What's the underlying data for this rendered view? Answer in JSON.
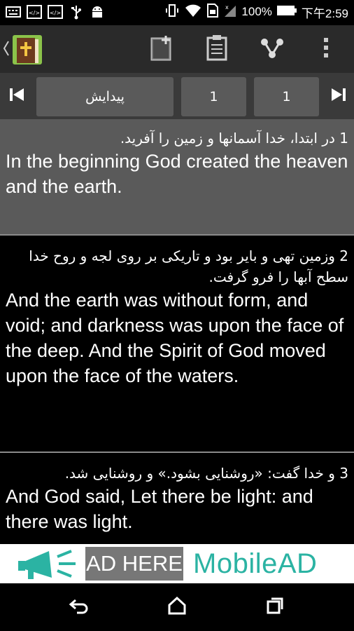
{
  "status_bar": {
    "left_icons": [
      "keyboard-icon",
      "code-icon",
      "code-icon",
      "usb-icon",
      "android-icon"
    ],
    "right_icons": [
      "vibrate-icon",
      "wifi-icon",
      "sim-icon",
      "signal-icon",
      "battery-icon"
    ],
    "battery": "100%",
    "time": "下午2:59"
  },
  "action_bar": {
    "icons": [
      "back-chevron-icon",
      "bible-book-icon",
      "bookmark-add-icon",
      "clipboard-icon",
      "share-icon",
      "overflow-menu-icon"
    ]
  },
  "nav_row": {
    "book": "پیدایش",
    "chapter": "1",
    "verse": "1"
  },
  "verses": [
    {
      "fa": "1 در ابتدا، خدا آسمانها و زمین را آفرید.",
      "en": "In the beginning God created the heaven and the earth."
    },
    {
      "fa": "2 وزمین تهی و بایر بود و تاریکی بر روی لجه و روح خدا سطح آبها را فرو گرفت.",
      "en": "And the earth was without form, and void; and darkness was upon the face of the deep. And the Spirit of God moved upon the face of the waters."
    },
    {
      "fa": "3 و خدا گفت: «روشنایی بشود.» و روشنایی شد.",
      "en": "And God said, Let there be light: and there was light."
    }
  ],
  "ad": {
    "placeholder": "AD HERE",
    "brand": "MobileAD",
    "brand_color": "#2bb3a3"
  },
  "nav_bar": {
    "icons": [
      "back-icon",
      "home-icon",
      "recents-icon"
    ]
  }
}
